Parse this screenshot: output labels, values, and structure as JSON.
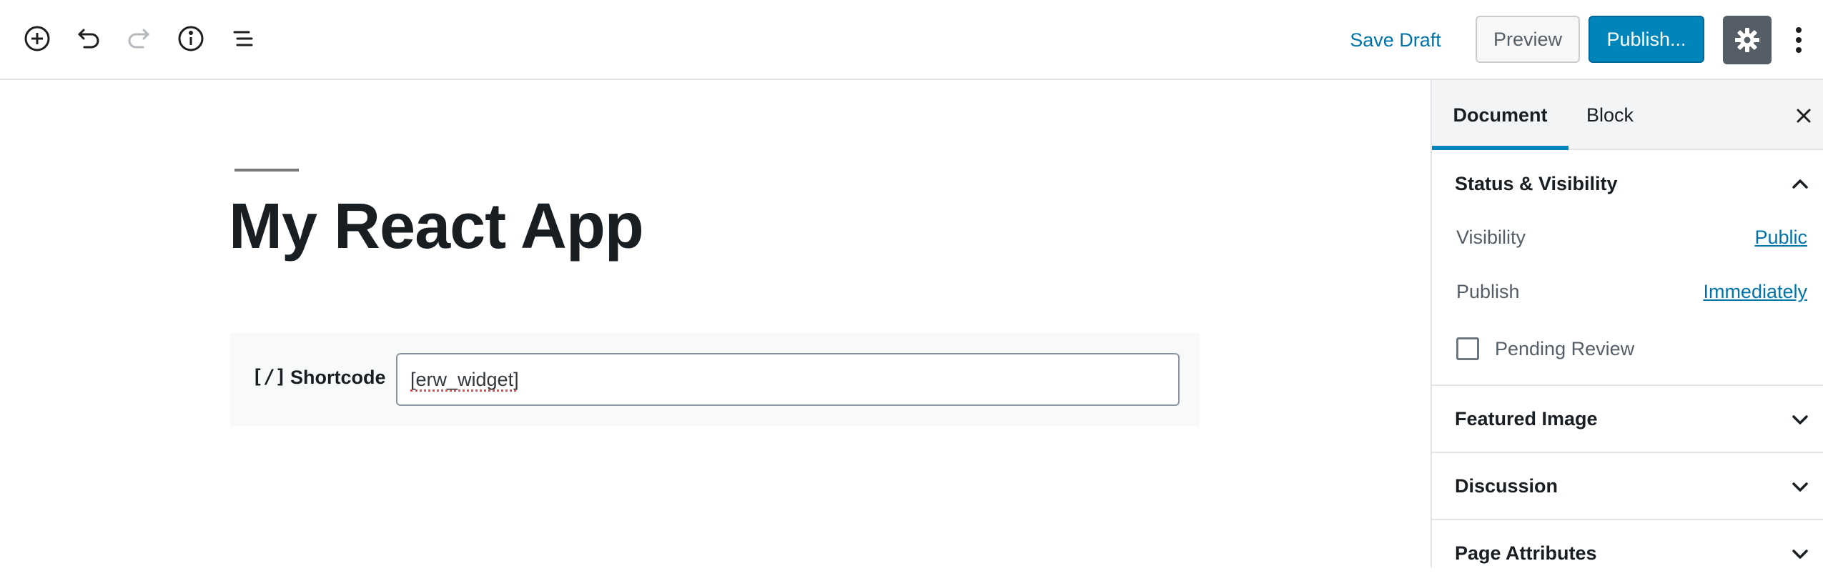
{
  "toolbar": {
    "icons": [
      "add-block-icon",
      "undo-icon",
      "redo-icon",
      "info-icon",
      "block-navigation-icon"
    ],
    "save_draft_label": "Save Draft",
    "preview_label": "Preview",
    "publish_label": "Publish...",
    "settings_icon": "gear-icon",
    "more_icon": "more-vertical-icon"
  },
  "editor": {
    "post_title": "My React App",
    "shortcode_block": {
      "icon_text": "[/]",
      "label": "Shortcode",
      "value": "[erw_widget]"
    }
  },
  "sidebar": {
    "tabs": [
      {
        "label": "Document",
        "active": true
      },
      {
        "label": "Block",
        "active": false
      }
    ],
    "close_icon": "close-icon",
    "panels": {
      "status_visibility": {
        "title": "Status & Visibility",
        "expanded": true,
        "visibility_label": "Visibility",
        "visibility_value": "Public",
        "publish_label": "Publish",
        "publish_value": "Immediately",
        "pending_review_label": "Pending Review",
        "pending_review_checked": false
      },
      "featured_image": {
        "title": "Featured Image",
        "expanded": false
      },
      "discussion": {
        "title": "Discussion",
        "expanded": false
      },
      "page_attributes": {
        "title": "Page Attributes",
        "expanded": false
      }
    }
  },
  "colors": {
    "accent": "#0085ba",
    "link": "#0073aa",
    "settings_bg": "#555d66"
  }
}
